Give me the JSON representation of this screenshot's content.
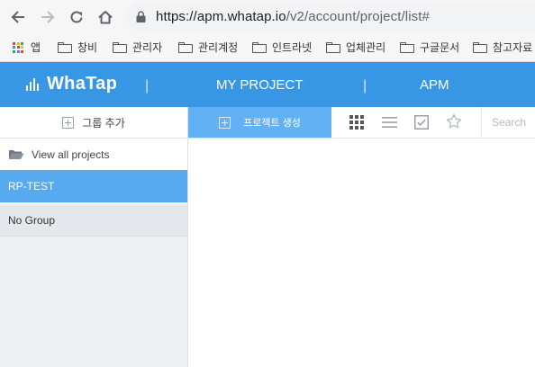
{
  "browser": {
    "url_host": "https://apm.whatap.io",
    "url_path": "/v2/account/project/list#",
    "bookmarks": [
      {
        "label": "앱",
        "icon": "apps-grid-icon"
      },
      {
        "label": "창비",
        "icon": "folder-icon"
      },
      {
        "label": "관리자",
        "icon": "folder-icon"
      },
      {
        "label": "관리계정",
        "icon": "folder-icon"
      },
      {
        "label": "인트라넷",
        "icon": "folder-icon"
      },
      {
        "label": "업체관리",
        "icon": "folder-icon"
      },
      {
        "label": "구글문서",
        "icon": "folder-icon"
      },
      {
        "label": "참고자료",
        "icon": "folder-icon"
      }
    ]
  },
  "header": {
    "logo_text": "WhaTap",
    "separator": "|",
    "nav": [
      "MY PROJECT",
      "APM"
    ],
    "color": "#3897e5"
  },
  "sidebar": {
    "add_group_label": "그룹 추가",
    "view_all_label": "View all projects",
    "groups": [
      {
        "label": "RP-TEST",
        "selected": true
      },
      {
        "label": "No Group",
        "selected": false
      }
    ]
  },
  "content": {
    "create_project_label": "프로젝트 생성",
    "view_icons": [
      "grid-view-icon",
      "list-view-icon",
      "checkbox-icon",
      "star-icon"
    ],
    "search_placeholder": "Search"
  },
  "colors": {
    "accent": "#3897e5",
    "selected": "#57aaf0",
    "create_button": "#62b1f4"
  }
}
